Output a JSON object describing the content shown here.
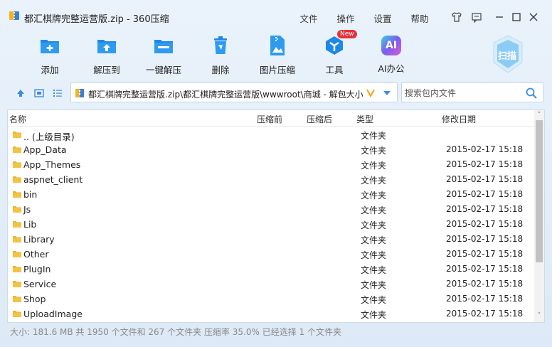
{
  "window": {
    "title": "都汇棋牌完整运营版.zip - 360压缩"
  },
  "menu": [
    "文件",
    "操作",
    "设置",
    "帮助"
  ],
  "toolbar": [
    {
      "label": "添加",
      "icon": "add-icon"
    },
    {
      "label": "解压到",
      "icon": "extract-to-icon"
    },
    {
      "label": "一键解压",
      "icon": "one-click-extract-icon"
    },
    {
      "label": "删除",
      "icon": "trash-icon"
    },
    {
      "label": "图片压缩",
      "icon": "image-compress-icon"
    },
    {
      "label": "工具",
      "icon": "tools-icon",
      "badge": "New"
    },
    {
      "label": "AI办公",
      "icon": "ai-office-icon",
      "glyph": "AI"
    }
  ],
  "scan": {
    "label": "扫描"
  },
  "address": {
    "path": "都汇棋牌完整运营版.zip\\都汇棋牌完整运营版\\wwwroot\\商城 - 解包大小"
  },
  "search": {
    "placeholder": "搜索包内文件"
  },
  "columns": {
    "name": "名称",
    "before": "压缩前",
    "after": "压缩后",
    "type": "类型",
    "date": "修改日期"
  },
  "rows": [
    {
      "name": ".. (上级目录)",
      "type": "文件夹",
      "date": ""
    },
    {
      "name": "App_Data",
      "type": "文件夹",
      "date": "2015-02-17 15:18"
    },
    {
      "name": "App_Themes",
      "type": "文件夹",
      "date": "2015-02-17 15:18"
    },
    {
      "name": "aspnet_client",
      "type": "文件夹",
      "date": "2015-02-17 15:18"
    },
    {
      "name": "bin",
      "type": "文件夹",
      "date": "2015-02-17 15:18"
    },
    {
      "name": "Js",
      "type": "文件夹",
      "date": "2015-02-17 15:18"
    },
    {
      "name": "Lib",
      "type": "文件夹",
      "date": "2015-02-17 15:18"
    },
    {
      "name": "Library",
      "type": "文件夹",
      "date": "2015-02-17 15:18"
    },
    {
      "name": "Other",
      "type": "文件夹",
      "date": "2015-02-17 15:18"
    },
    {
      "name": "PlugIn",
      "type": "文件夹",
      "date": "2015-02-17 15:18"
    },
    {
      "name": "Service",
      "type": "文件夹",
      "date": "2015-02-17 15:18"
    },
    {
      "name": "Shop",
      "type": "文件夹",
      "date": "2015-02-17 15:18"
    },
    {
      "name": "UploadImage",
      "type": "文件夹",
      "date": "2015-02-17 15:18"
    }
  ],
  "status": "大小: 181.6 MB 共 1950 个文件和 267 个文件夹 压缩率 35.0% 已经选择 1 个文件夹",
  "colors": {
    "accent": "#1e88e5",
    "folder": "#f5c342"
  }
}
